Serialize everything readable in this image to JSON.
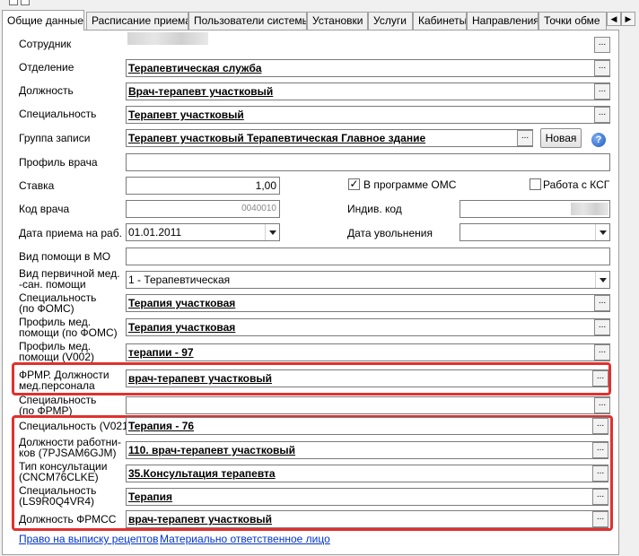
{
  "tabs": [
    "Общие данные",
    "Расписание приема",
    "Пользователи системы",
    "Установки",
    "Услуги",
    "Кабинеты",
    "Направления",
    "Точки обме"
  ],
  "form": {
    "sotrudnik": {
      "label": "Сотрудник",
      "value": ""
    },
    "otdelenie": {
      "label": "Отделение",
      "value": "Терапевтическая служба"
    },
    "dolzhnost": {
      "label": "Должность",
      "value": "Врач-терапевт участковый"
    },
    "specialnost": {
      "label": "Специальность",
      "value": "Терапевт участковый"
    },
    "gruppa": {
      "label": "Группа записи",
      "value": "Терапевт участковый Терапевтическая Главное здание",
      "new_button": "Новая"
    },
    "profil_vracha": {
      "label": "Профиль врача",
      "value": ""
    },
    "stavka": {
      "label": "Ставка",
      "value": "1,00"
    },
    "oms_checkbox": {
      "label": "В программе ОМС",
      "checked": true
    },
    "ksg_checkbox": {
      "label": "Работа с КСГ",
      "checked": false
    },
    "kod_vracha": {
      "label": "Код врача",
      "value": "0040010"
    },
    "indiv_kod": {
      "label": "Индив. код",
      "value": ""
    },
    "data_priema": {
      "label": "Дата приема на раб.",
      "value": "01.01.2011"
    },
    "data_uvolneniya": {
      "label": "Дата увольнения",
      "value": ""
    },
    "vid_pomoshi_mo": {
      "label": "Вид помощи в МО",
      "value": ""
    },
    "vid_pervichnoy": {
      "label_line1": "Вид первичной мед.",
      "label_line2": "-сан. помощи",
      "value": "1 - Терапевтическая"
    },
    "spec_foms": {
      "label_line1": "Специальность",
      "label_line2": "(по ФОМС)",
      "value": "Терапия участковая"
    },
    "profil_foms": {
      "label_line1": "Профиль  мед.",
      "label_line2": "помощи (по ФОМС)",
      "value": "Терапия участковая"
    },
    "profil_v002": {
      "label_line1": "Профиль  мед.",
      "label_line2": "помощи (V002)",
      "value": "терапии - 97"
    },
    "frmr_dolzh": {
      "label_line1": "ФРМР. Должности",
      "label_line2": "мед.персонала",
      "value": "врач-терапевт участковый"
    },
    "spec_frmr": {
      "label_line1": "Специальность",
      "label_line2": "(по ФРМР)",
      "value": ""
    },
    "spec_v021": {
      "label": "Специальность (V021)",
      "value": "Терапия - 76"
    },
    "dolzh_rabotnikov": {
      "label_line1": "Должности работни-",
      "label_line2": "ков (7PJSAM6GJM)",
      "value": "110. врач-терапевт участковый"
    },
    "tip_konsult": {
      "label_line1": "Тип консультации",
      "label_line2": "(CNCM76CLKE)",
      "value": "35.Консультация терапевта"
    },
    "spec_ls9": {
      "label_line1": "Специальность",
      "label_line2": "(LS9R0Q4VR4)",
      "value": "Терапия"
    },
    "dolzh_frmss": {
      "label": "Должность ФРМСС",
      "value": "врач-терапевт участковый"
    }
  },
  "links": {
    "recipes": "Право на выписку рецептов",
    "responsible": "Материально ответственное лицо"
  },
  "colors": {
    "highlight_red": "#e0312f",
    "link_blue": "#0033cc"
  },
  "icons": {
    "dots_button": "...",
    "help": "?",
    "tab_left": "◀",
    "tab_right": "▶"
  }
}
